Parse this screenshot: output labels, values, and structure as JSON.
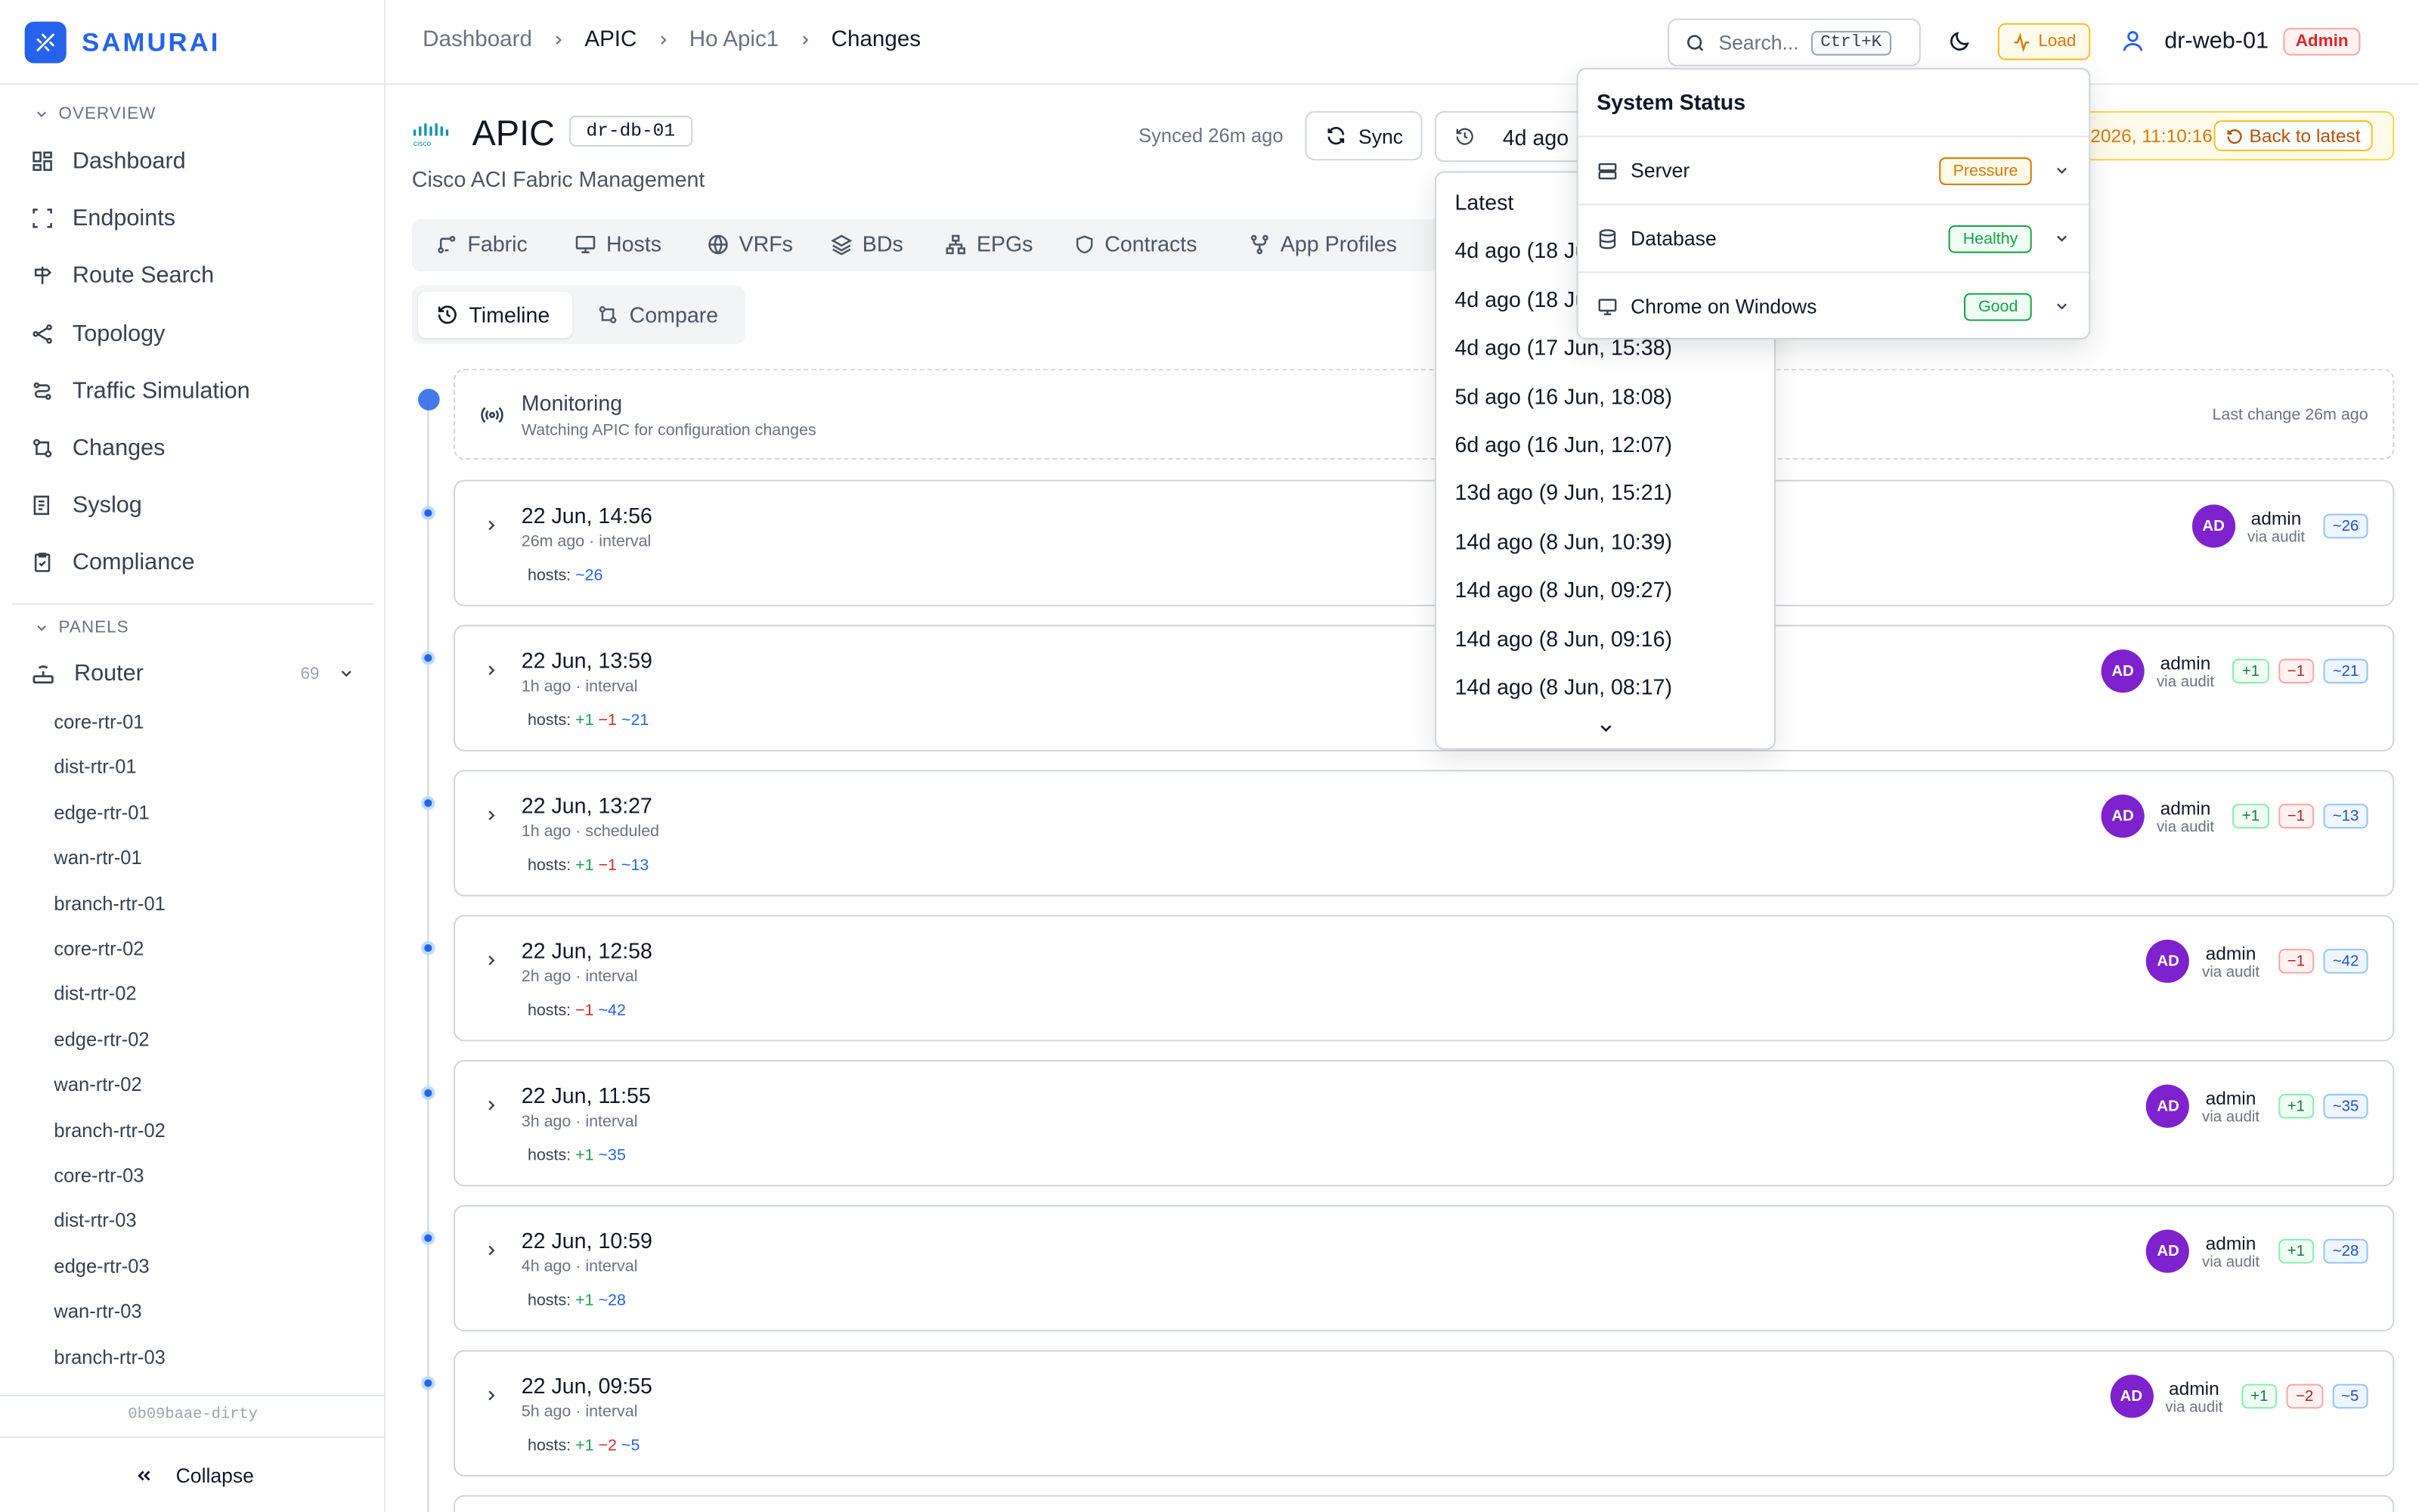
{
  "app": {
    "name": "SAMURAI"
  },
  "sidebar": {
    "overview_label": "OVERVIEW",
    "nav": [
      {
        "label": "Dashboard",
        "icon": "dashboard-icon"
      },
      {
        "label": "Endpoints",
        "icon": "endpoints-icon"
      },
      {
        "label": "Route Search",
        "icon": "route-search-icon"
      },
      {
        "label": "Topology",
        "icon": "topology-icon"
      },
      {
        "label": "Traffic Simulation",
        "icon": "traffic-icon"
      },
      {
        "label": "Changes",
        "icon": "changes-icon"
      },
      {
        "label": "Syslog",
        "icon": "syslog-icon"
      },
      {
        "label": "Compliance",
        "icon": "compliance-icon"
      }
    ],
    "panels_label": "PANELS",
    "router": {
      "label": "Router",
      "count": "69"
    },
    "routers": [
      "core-rtr-01",
      "dist-rtr-01",
      "edge-rtr-01",
      "wan-rtr-01",
      "branch-rtr-01",
      "core-rtr-02",
      "dist-rtr-02",
      "edge-rtr-02",
      "wan-rtr-02",
      "branch-rtr-02",
      "core-rtr-03",
      "dist-rtr-03",
      "edge-rtr-03",
      "wan-rtr-03",
      "branch-rtr-03"
    ],
    "version": "0b09baae-dirty",
    "collapse_label": "Collapse"
  },
  "breadcrumb": [
    "Dashboard",
    "APIC",
    "Ho Apic1",
    "Changes"
  ],
  "topbar": {
    "search_placeholder": "Search...",
    "shortcut": "Ctrl+K",
    "load_label": "Load",
    "user": "dr-web-01",
    "role": "Admin"
  },
  "header": {
    "title": "APIC",
    "device_tag": "dr-db-01",
    "subtitle": "Cisco ACI Fabric Management",
    "synced": "Synced 26m ago",
    "sync_label": "Sync",
    "time_label": "4d ago",
    "history_date": "2026, 11:10:16",
    "back_label": "Back to latest"
  },
  "tabs": [
    {
      "label": "Fabric",
      "icon": "fabric-icon"
    },
    {
      "label": "Hosts",
      "icon": "hosts-icon"
    },
    {
      "label": "VRFs",
      "icon": "globe-icon"
    },
    {
      "label": "BDs",
      "icon": "layers-icon"
    },
    {
      "label": "EPGs",
      "icon": "network-icon"
    },
    {
      "label": "Contracts",
      "icon": "shield-icon"
    },
    {
      "label": "App Profiles",
      "icon": "app-profiles-icon"
    }
  ],
  "subtabs": [
    {
      "label": "Timeline",
      "icon": "history-icon"
    },
    {
      "label": "Compare",
      "icon": "compare-icon"
    }
  ],
  "monitoring": {
    "title": "Monitoring",
    "desc": "Watching APIC for configuration changes",
    "last_change": "Last change 26m ago"
  },
  "changes": [
    {
      "date": "22 Jun, 14:56",
      "meta": "26m ago · interval",
      "hosts": [
        {
          "t": "~26",
          "c": "b"
        }
      ],
      "user": "admin",
      "via": "via audit",
      "initials": "AD"
    },
    {
      "date": "22 Jun, 13:59",
      "meta": "1h ago · interval",
      "hosts": [
        {
          "t": "+1",
          "c": "g"
        },
        {
          "t": "−1",
          "c": "r"
        },
        {
          "t": "~21",
          "c": "b"
        }
      ],
      "user": "admin",
      "via": "via audit",
      "initials": "AD"
    },
    {
      "date": "22 Jun, 13:27",
      "meta": "1h ago · scheduled",
      "hosts": [
        {
          "t": "+1",
          "c": "g"
        },
        {
          "t": "−1",
          "c": "r"
        },
        {
          "t": "~13",
          "c": "b"
        }
      ],
      "user": "admin",
      "via": "via audit",
      "initials": "AD"
    },
    {
      "date": "22 Jun, 12:58",
      "meta": "2h ago · interval",
      "hosts": [
        {
          "t": "−1",
          "c": "r"
        },
        {
          "t": "~42",
          "c": "b"
        }
      ],
      "user": "admin",
      "via": "via audit",
      "initials": "AD"
    },
    {
      "date": "22 Jun, 11:55",
      "meta": "3h ago · interval",
      "hosts": [
        {
          "t": "+1",
          "c": "g"
        },
        {
          "t": "~35",
          "c": "b"
        }
      ],
      "user": "admin",
      "via": "via audit",
      "initials": "AD"
    },
    {
      "date": "22 Jun, 10:59",
      "meta": "4h ago · interval",
      "hosts": [
        {
          "t": "+1",
          "c": "g"
        },
        {
          "t": "~28",
          "c": "b"
        }
      ],
      "user": "admin",
      "via": "via audit",
      "initials": "AD"
    },
    {
      "date": "22 Jun, 09:55",
      "meta": "5h ago · interval",
      "hosts": [
        {
          "t": "+1",
          "c": "g"
        },
        {
          "t": "−2",
          "c": "r"
        },
        {
          "t": "~5",
          "c": "b"
        }
      ],
      "user": "admin",
      "via": "via audit",
      "initials": "AD"
    }
  ],
  "hosts_label": "hosts:",
  "time_dropdown": [
    "Latest",
    "4d ago (18 Ju",
    "4d ago (18 Ju",
    "4d ago (17 Jun, 15:38)",
    "5d ago (16 Jun, 18:08)",
    "6d ago (16 Jun, 12:07)",
    "13d ago (9 Jun, 15:21)",
    "14d ago (8 Jun, 10:39)",
    "14d ago (8 Jun, 09:27)",
    "14d ago (8 Jun, 09:16)",
    "14d ago (8 Jun, 08:17)"
  ],
  "system_status": {
    "title": "System Status",
    "rows": [
      {
        "label": "Server",
        "status": "Pressure",
        "icon": "server-icon",
        "color": "#d97706"
      },
      {
        "label": "Database",
        "status": "Healthy",
        "icon": "database-icon",
        "color": "#16a34a"
      },
      {
        "label": "Chrome on Windows",
        "status": "Good",
        "icon": "monitor-icon",
        "color": "#16a34a"
      }
    ]
  },
  "colors": {
    "accent": "#2563eb",
    "avatar": "#7e22ce",
    "warning": "#d97706"
  }
}
